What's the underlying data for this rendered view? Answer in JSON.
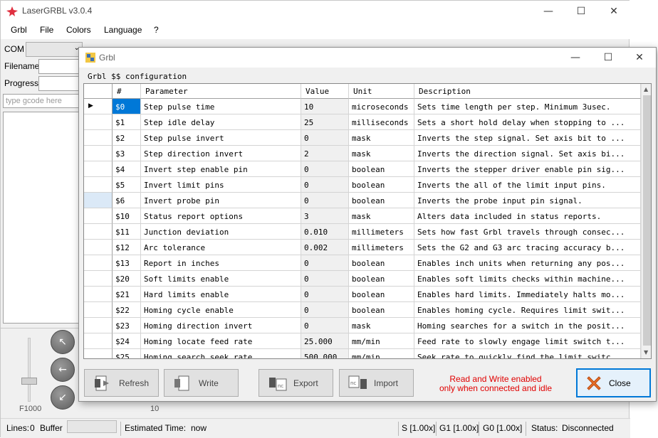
{
  "app": {
    "title": "LaserGRBL v3.0.4",
    "menu": [
      "Grbl",
      "File",
      "Colors",
      "Language",
      "?"
    ]
  },
  "left": {
    "com_label": "COM",
    "filename_label": "Filename",
    "progress_label": "Progress",
    "gcode_placeholder": "type gcode here",
    "feed_label": "F1000",
    "step_label": "10"
  },
  "status": {
    "lines_label": "Lines:",
    "lines_value": "0",
    "buffer_label": "Buffer",
    "estimated_label": "Estimated Time:",
    "estimated_value": "now",
    "s_override": "S [1.00x]",
    "g1_override": "G1 [1.00x]",
    "g0_override": "G0 [1.00x]",
    "status_label": "Status:",
    "status_value": "Disconnected"
  },
  "dialog": {
    "title": "Grbl",
    "group_label": "Grbl $$ configuration",
    "columns": [
      "#",
      "Parameter",
      "Value",
      "Unit",
      "Description"
    ],
    "rows": [
      {
        "id": "$0",
        "param": "Step pulse time",
        "value": "10",
        "unit": "microseconds",
        "desc": "Sets time length per step. Minimum 3usec."
      },
      {
        "id": "$1",
        "param": "Step idle delay",
        "value": "25",
        "unit": "milliseconds",
        "desc": "Sets a short hold delay when stopping to ..."
      },
      {
        "id": "$2",
        "param": "Step pulse invert",
        "value": "0",
        "unit": "mask",
        "desc": "Inverts the step signal. Set axis bit to ..."
      },
      {
        "id": "$3",
        "param": "Step direction invert",
        "value": "2",
        "unit": "mask",
        "desc": "Inverts the direction signal. Set axis bi..."
      },
      {
        "id": "$4",
        "param": "Invert step enable pin",
        "value": "0",
        "unit": "boolean",
        "desc": "Inverts the stepper driver enable pin sig..."
      },
      {
        "id": "$5",
        "param": "Invert limit pins",
        "value": "0",
        "unit": "boolean",
        "desc": "Inverts the all of the limit input pins."
      },
      {
        "id": "$6",
        "param": "Invert probe pin",
        "value": "0",
        "unit": "boolean",
        "desc": "Inverts the probe input pin signal."
      },
      {
        "id": "$10",
        "param": "Status report options",
        "value": "3",
        "unit": "mask",
        "desc": "Alters data included in status reports."
      },
      {
        "id": "$11",
        "param": "Junction deviation",
        "value": "0.010",
        "unit": "millimeters",
        "desc": "Sets how fast Grbl travels through consec..."
      },
      {
        "id": "$12",
        "param": "Arc tolerance",
        "value": "0.002",
        "unit": "millimeters",
        "desc": "Sets the G2 and G3 arc tracing accuracy b..."
      },
      {
        "id": "$13",
        "param": "Report in inches",
        "value": "0",
        "unit": "boolean",
        "desc": "Enables inch units when returning any pos..."
      },
      {
        "id": "$20",
        "param": "Soft limits enable",
        "value": "0",
        "unit": "boolean",
        "desc": "Enables soft limits checks within machine..."
      },
      {
        "id": "$21",
        "param": "Hard limits enable",
        "value": "0",
        "unit": "boolean",
        "desc": "Enables hard limits. Immediately halts mo..."
      },
      {
        "id": "$22",
        "param": "Homing cycle enable",
        "value": "0",
        "unit": "boolean",
        "desc": "Enables homing cycle. Requires limit swit..."
      },
      {
        "id": "$23",
        "param": "Homing direction invert",
        "value": "0",
        "unit": "mask",
        "desc": "Homing searches for a switch in the posit..."
      },
      {
        "id": "$24",
        "param": "Homing locate feed rate",
        "value": "25.000",
        "unit": "mm/min",
        "desc": "Feed rate to slowly engage limit switch t..."
      },
      {
        "id": "$25",
        "param": "Homing search seek rate",
        "value": "500.000",
        "unit": "mm/min",
        "desc": "Seek rate to quickly find the limit switc..."
      }
    ],
    "buttons": {
      "refresh": "Refresh",
      "write": "Write",
      "export": "Export",
      "import": "Import",
      "close": "Close"
    },
    "note_line1": "Read and Write enabled",
    "note_line2": "only when connected and idle"
  },
  "colors": {
    "accent": "#0078d7",
    "note": "#e00000"
  }
}
